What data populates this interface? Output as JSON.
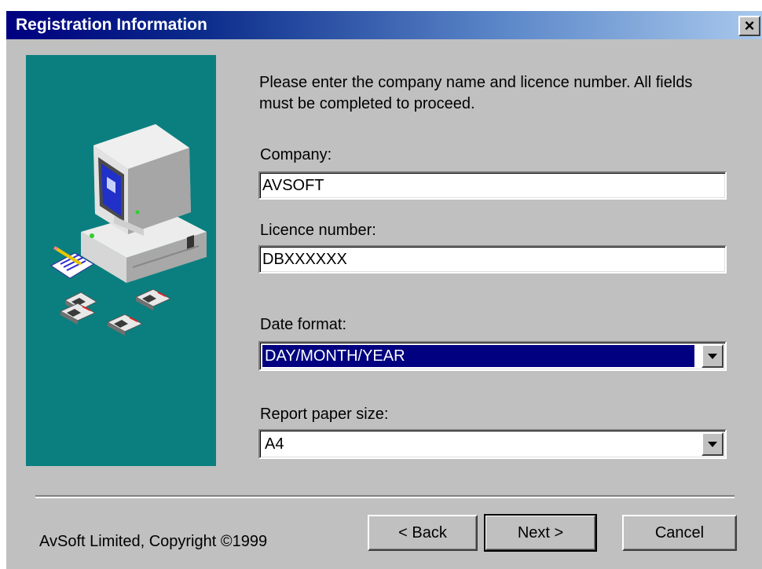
{
  "window": {
    "title": "Registration Information",
    "close_label": "×"
  },
  "intro_text": "Please enter the company name and licence number. All fields must be completed to proceed.",
  "fields": {
    "company_label": "Company:",
    "company_value": "AVSOFT",
    "licence_label": "Licence number:",
    "licence_value": "DBXXXXXX",
    "date_format_label": "Date format:",
    "date_format_value": "DAY/MONTH/YEAR",
    "paper_size_label": "Report paper size:",
    "paper_size_value": "A4"
  },
  "footer": {
    "copyright": "AvSoft Limited, Copyright ©1999",
    "back_label": "< Back",
    "next_label": "Next >",
    "cancel_label": "Cancel"
  },
  "colors": {
    "title_bar": "#000080",
    "art_panel": "#0b7f7f",
    "selection": "#000080",
    "dialog_face": "#c0c0c0"
  },
  "icons": [
    "close-icon",
    "computer-illustration",
    "dropdown-arrow-icon"
  ]
}
